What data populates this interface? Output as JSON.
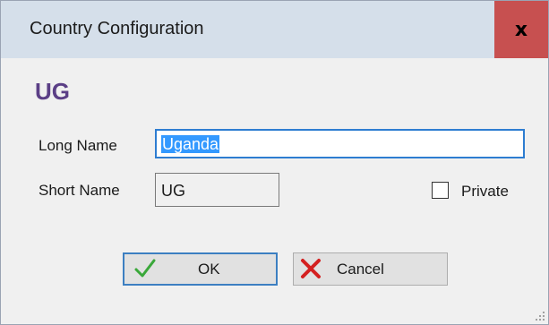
{
  "window": {
    "title": "Country Configuration",
    "close_label": "x"
  },
  "header": {
    "code": "UG"
  },
  "form": {
    "long_name_label": "Long Name",
    "long_name_value": "Uganda",
    "short_name_label": "Short Name",
    "short_name_value": "UG",
    "private_label": "Private",
    "private_checked": false
  },
  "buttons": {
    "ok_label": "OK",
    "cancel_label": "Cancel"
  },
  "icons": {
    "ok": "checkmark-icon",
    "cancel": "red-x-icon",
    "grip": "resize-grip-icon"
  },
  "colors": {
    "title_bar": "#d5dfea",
    "close_button": "#c75050",
    "heading": "#5b3f86",
    "selection": "#3399ff",
    "focus_border": "#2e7dd1"
  }
}
